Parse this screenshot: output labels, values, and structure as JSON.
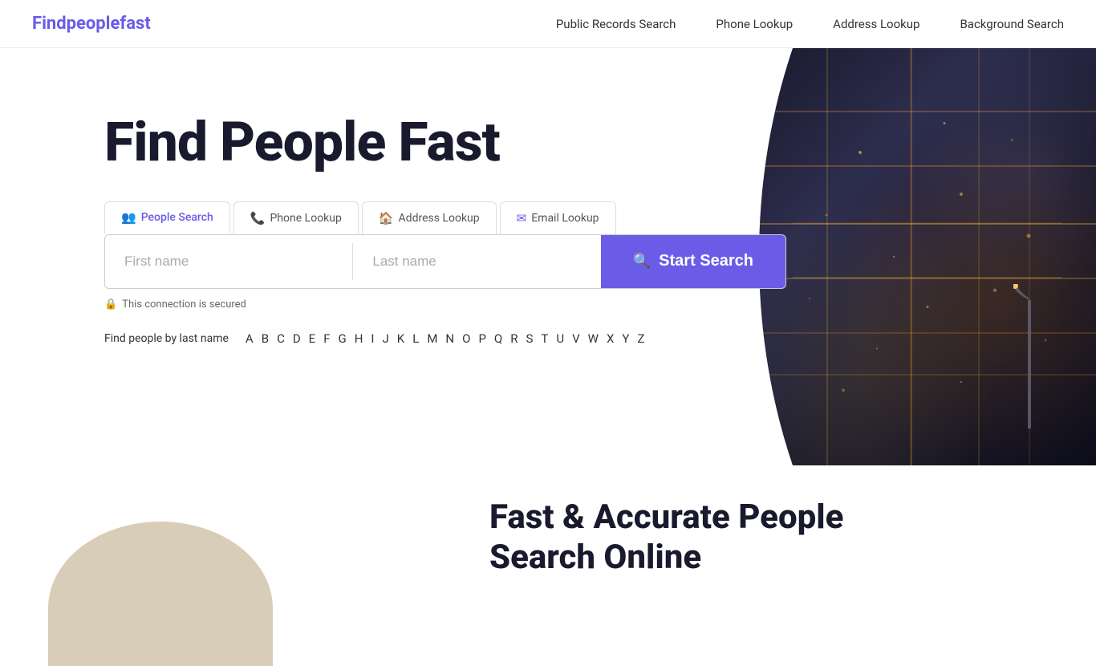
{
  "header": {
    "logo": "Findpeoplefast",
    "nav": [
      {
        "label": "Public Records Search",
        "id": "public-records"
      },
      {
        "label": "Phone Lookup",
        "id": "phone-lookup"
      },
      {
        "label": "Address Lookup",
        "id": "address-lookup"
      },
      {
        "label": "Background Search",
        "id": "background-search"
      }
    ]
  },
  "hero": {
    "title": "Find People Fast",
    "tabs": [
      {
        "id": "people-search",
        "label": "People Search",
        "active": true,
        "icon": "👥"
      },
      {
        "id": "phone-lookup",
        "label": "Phone Lookup",
        "active": false,
        "icon": "📞"
      },
      {
        "id": "address-lookup",
        "label": "Address Lookup",
        "active": false,
        "icon": "🏠"
      },
      {
        "id": "email-lookup",
        "label": "Email Lookup",
        "active": false,
        "icon": "✉"
      }
    ],
    "search": {
      "first_name_placeholder": "First name",
      "last_name_placeholder": "Last name",
      "button_label": "Start Search"
    },
    "secure_note": "This connection is secured",
    "alphabet_label": "Find people by last name",
    "alphabet": [
      "A",
      "B",
      "C",
      "D",
      "E",
      "F",
      "G",
      "H",
      "I",
      "J",
      "K",
      "L",
      "M",
      "N",
      "O",
      "P",
      "Q",
      "R",
      "S",
      "T",
      "U",
      "V",
      "W",
      "X",
      "Y",
      "Z"
    ]
  },
  "bottom": {
    "title_line1": "Fast & Accurate People",
    "title_line2": "Search Online"
  },
  "colors": {
    "accent": "#6b5ce7",
    "dark": "#1a1a2e"
  }
}
